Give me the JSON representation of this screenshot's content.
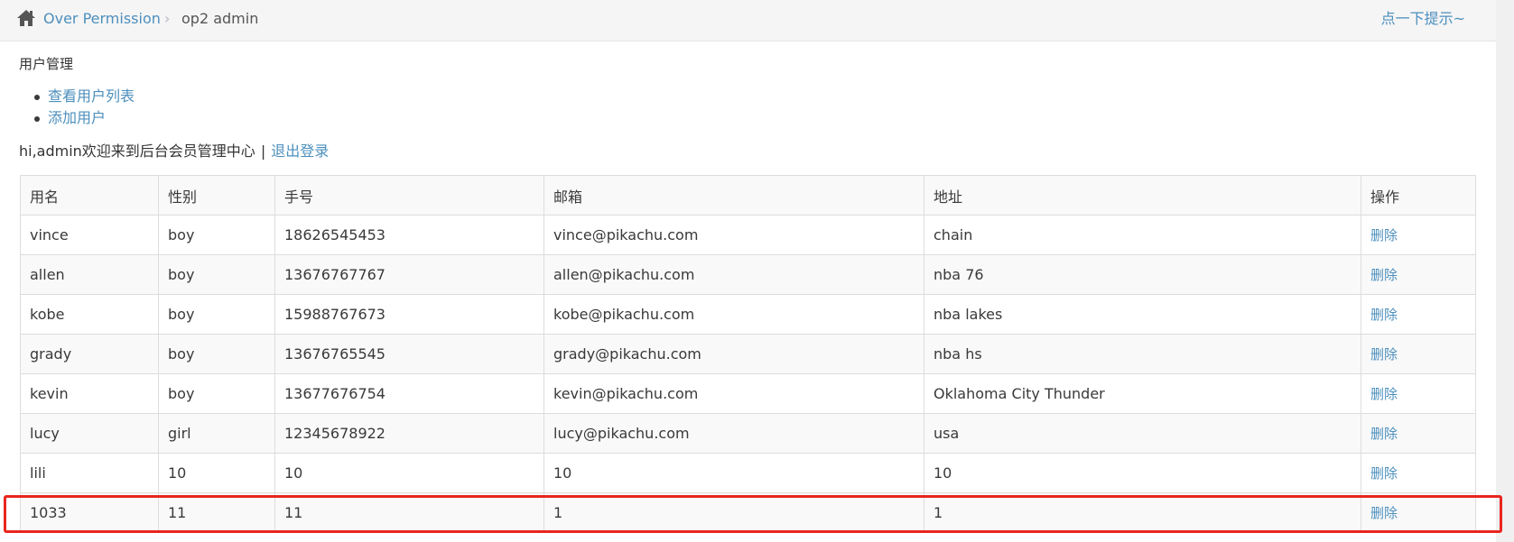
{
  "breadcrumb": {
    "home_icon": "home-icon",
    "link_label": "Over Permission",
    "separator": "›",
    "current_label": "op2 admin",
    "hint_label": "点一下提示~"
  },
  "main": {
    "section_title": "用户管理",
    "menu_items": [
      {
        "label": "查看用户列表"
      },
      {
        "label": "添加用户"
      }
    ],
    "welcome_text": "hi,admin欢迎来到后台会员管理中心",
    "welcome_separator": "|",
    "logout_label": "退出登录"
  },
  "table": {
    "headers": [
      "用名",
      "性别",
      "手号",
      "邮箱",
      "地址",
      "操作"
    ],
    "rows": [
      {
        "name": "vince",
        "sex": "boy",
        "phone": "18626545453",
        "email": "vince@pikachu.com",
        "address": "chain",
        "action": "删除"
      },
      {
        "name": "allen",
        "sex": "boy",
        "phone": "13676767767",
        "email": "allen@pikachu.com",
        "address": "nba 76",
        "action": "删除"
      },
      {
        "name": "kobe",
        "sex": "boy",
        "phone": "15988767673",
        "email": "kobe@pikachu.com",
        "address": "nba lakes",
        "action": "删除"
      },
      {
        "name": "grady",
        "sex": "boy",
        "phone": "13676765545",
        "email": "grady@pikachu.com",
        "address": "nba hs",
        "action": "删除"
      },
      {
        "name": "kevin",
        "sex": "boy",
        "phone": "13677676754",
        "email": "kevin@pikachu.com",
        "address": "Oklahoma City Thunder",
        "action": "删除"
      },
      {
        "name": "lucy",
        "sex": "girl",
        "phone": "12345678922",
        "email": "lucy@pikachu.com",
        "address": "usa",
        "action": "删除"
      },
      {
        "name": "lili",
        "sex": "10",
        "phone": "10",
        "email": "10",
        "address": "10",
        "action": "删除"
      },
      {
        "name": "1033",
        "sex": "11",
        "phone": "11",
        "email": "1",
        "address": "1",
        "action": "删除"
      }
    ]
  },
  "colors": {
    "link": "#4c8fbd",
    "highlight_border": "#e8261f"
  }
}
